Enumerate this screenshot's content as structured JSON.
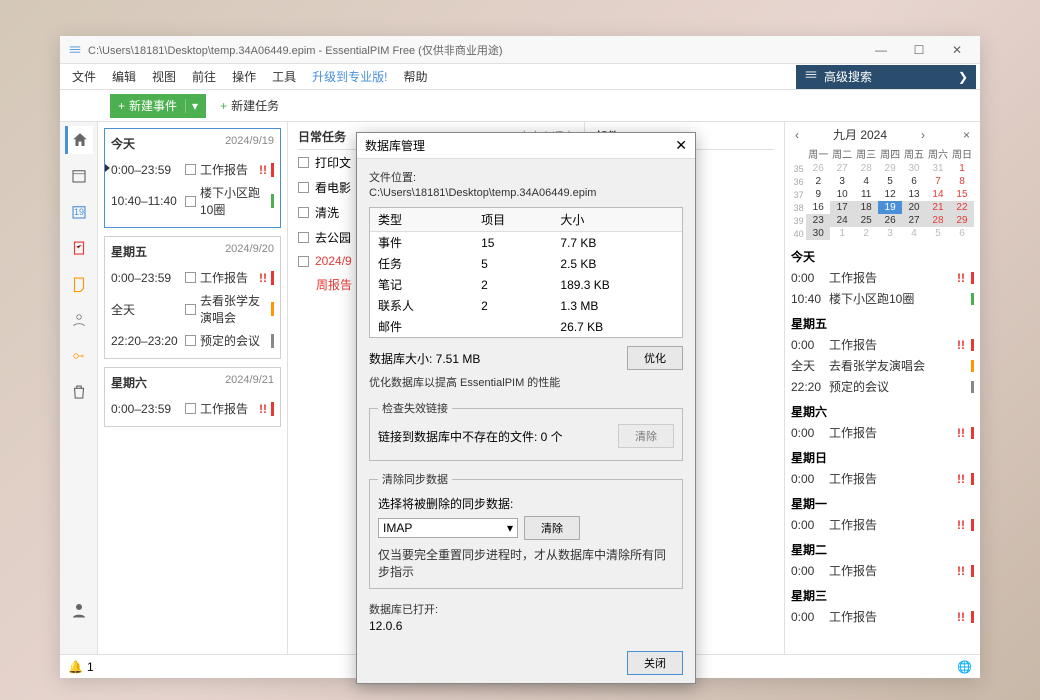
{
  "titlebar": {
    "text": "C:\\Users\\18181\\Desktop\\temp.34A06449.epim - EssentialPIM Free (仅供非商业用途)"
  },
  "menu": {
    "file": "文件",
    "edit": "编辑",
    "view": "视图",
    "go": "前往",
    "actions": "操作",
    "tools": "工具",
    "upgrade": "升级到专业版!",
    "help": "帮助"
  },
  "search": {
    "label": "高级搜索"
  },
  "toolbar": {
    "newEvent": "新建事件",
    "newTask": "新建任务"
  },
  "events": {
    "today": {
      "label": "今天",
      "date": "2024/9/19",
      "rows": [
        {
          "time": "0:00–23:59",
          "text": "工作报告",
          "mark": "!!",
          "bar": "#e53935"
        },
        {
          "time": "10:40–11:40",
          "text": "楼下小区跑10圈",
          "bar": "#4caf50"
        }
      ]
    },
    "friday": {
      "label": "星期五",
      "date": "2024/9/20",
      "rows": [
        {
          "time": "0:00–23:59",
          "text": "工作报告",
          "mark": "!!",
          "bar": "#e53935"
        },
        {
          "time": "全天",
          "text": "去看张学友演唱会",
          "bar": "#ff9800"
        },
        {
          "time": "22:20–23:20",
          "text": "预定的会议",
          "bar": "#888"
        }
      ]
    },
    "saturday": {
      "label": "星期六",
      "date": "2024/9/21",
      "rows": [
        {
          "time": "0:00–23:59",
          "text": "工作报告",
          "mark": "!!",
          "bar": "#e53935"
        }
      ]
    }
  },
  "tasks": {
    "title": "日常任务",
    "sort": "自定义顺序",
    "rows": [
      "打印文",
      "看电影",
      "清洗",
      "去公园"
    ],
    "redRow": {
      "date": "2024/9",
      "text": "周报告"
    }
  },
  "mail": {
    "title": "邮件"
  },
  "calendar": {
    "month": "九月   2024",
    "heads": [
      "周一",
      "周二",
      "周三",
      "周四",
      "周五",
      "周六",
      "周日"
    ],
    "weeks": [
      "35",
      "36",
      "37",
      "38",
      "39",
      "40"
    ]
  },
  "agenda": {
    "sections": [
      {
        "day": "今天",
        "rows": [
          {
            "time": "0:00",
            "text": "工作报告",
            "mark": "!!",
            "bar": "#e53935"
          },
          {
            "time": "10:40",
            "text": "楼下小区跑10圈",
            "bar": "#4caf50"
          }
        ]
      },
      {
        "day": "星期五",
        "rows": [
          {
            "time": "0:00",
            "text": "工作报告",
            "mark": "!!",
            "bar": "#e53935"
          },
          {
            "time": "全天",
            "text": "去看张学友演唱会",
            "bar": "#ff9800"
          },
          {
            "time": "22:20",
            "text": "预定的会议",
            "bar": "#888"
          }
        ]
      },
      {
        "day": "星期六",
        "rows": [
          {
            "time": "0:00",
            "text": "工作报告",
            "mark": "!!",
            "bar": "#e53935"
          }
        ]
      },
      {
        "day": "星期日",
        "rows": [
          {
            "time": "0:00",
            "text": "工作报告",
            "mark": "!!",
            "bar": "#e53935"
          }
        ]
      },
      {
        "day": "星期一",
        "rows": [
          {
            "time": "0:00",
            "text": "工作报告",
            "mark": "!!",
            "bar": "#e53935"
          }
        ]
      },
      {
        "day": "星期二",
        "rows": [
          {
            "time": "0:00",
            "text": "工作报告",
            "mark": "!!",
            "bar": "#e53935"
          }
        ]
      },
      {
        "day": "星期三",
        "rows": [
          {
            "time": "0:00",
            "text": "工作报告",
            "mark": "!!",
            "bar": "#e53935"
          }
        ]
      }
    ]
  },
  "dialog": {
    "title": "数据库管理",
    "locLabel": "文件位置:",
    "locPath": "C:\\Users\\18181\\Desktop\\temp.34A06449.epim",
    "cols": {
      "type": "类型",
      "items": "项目",
      "size": "大小"
    },
    "rows": [
      {
        "type": "事件",
        "items": "15",
        "size": "7.7 KB"
      },
      {
        "type": "任务",
        "items": "5",
        "size": "2.5 KB"
      },
      {
        "type": "笔记",
        "items": "2",
        "size": "189.3 KB"
      },
      {
        "type": "联系人",
        "items": "2",
        "size": "1.3 MB"
      },
      {
        "type": "邮件",
        "items": "",
        "size": "26.7 KB"
      }
    ],
    "dbSize": "数据库大小: 7.51 MB",
    "btnOptimize": "优化",
    "optNote": "优化数据库以提高 EssentialPIM 的性能",
    "checkLegend": "检查失效链接",
    "checkText": "链接到数据库中不存在的文件: 0 个",
    "btnClear": "清除",
    "syncLegend": "清除同步数据",
    "syncText": "选择将被删除的同步数据:",
    "syncSel": "IMAP",
    "syncNote": "仅当要完全重置同步进程时，才从数据库中清除所有同步指示",
    "openLabel": "数据库已打开:",
    "openVal": "12.0.6",
    "btnClose": "关闭"
  },
  "status": {
    "bell": "1"
  }
}
